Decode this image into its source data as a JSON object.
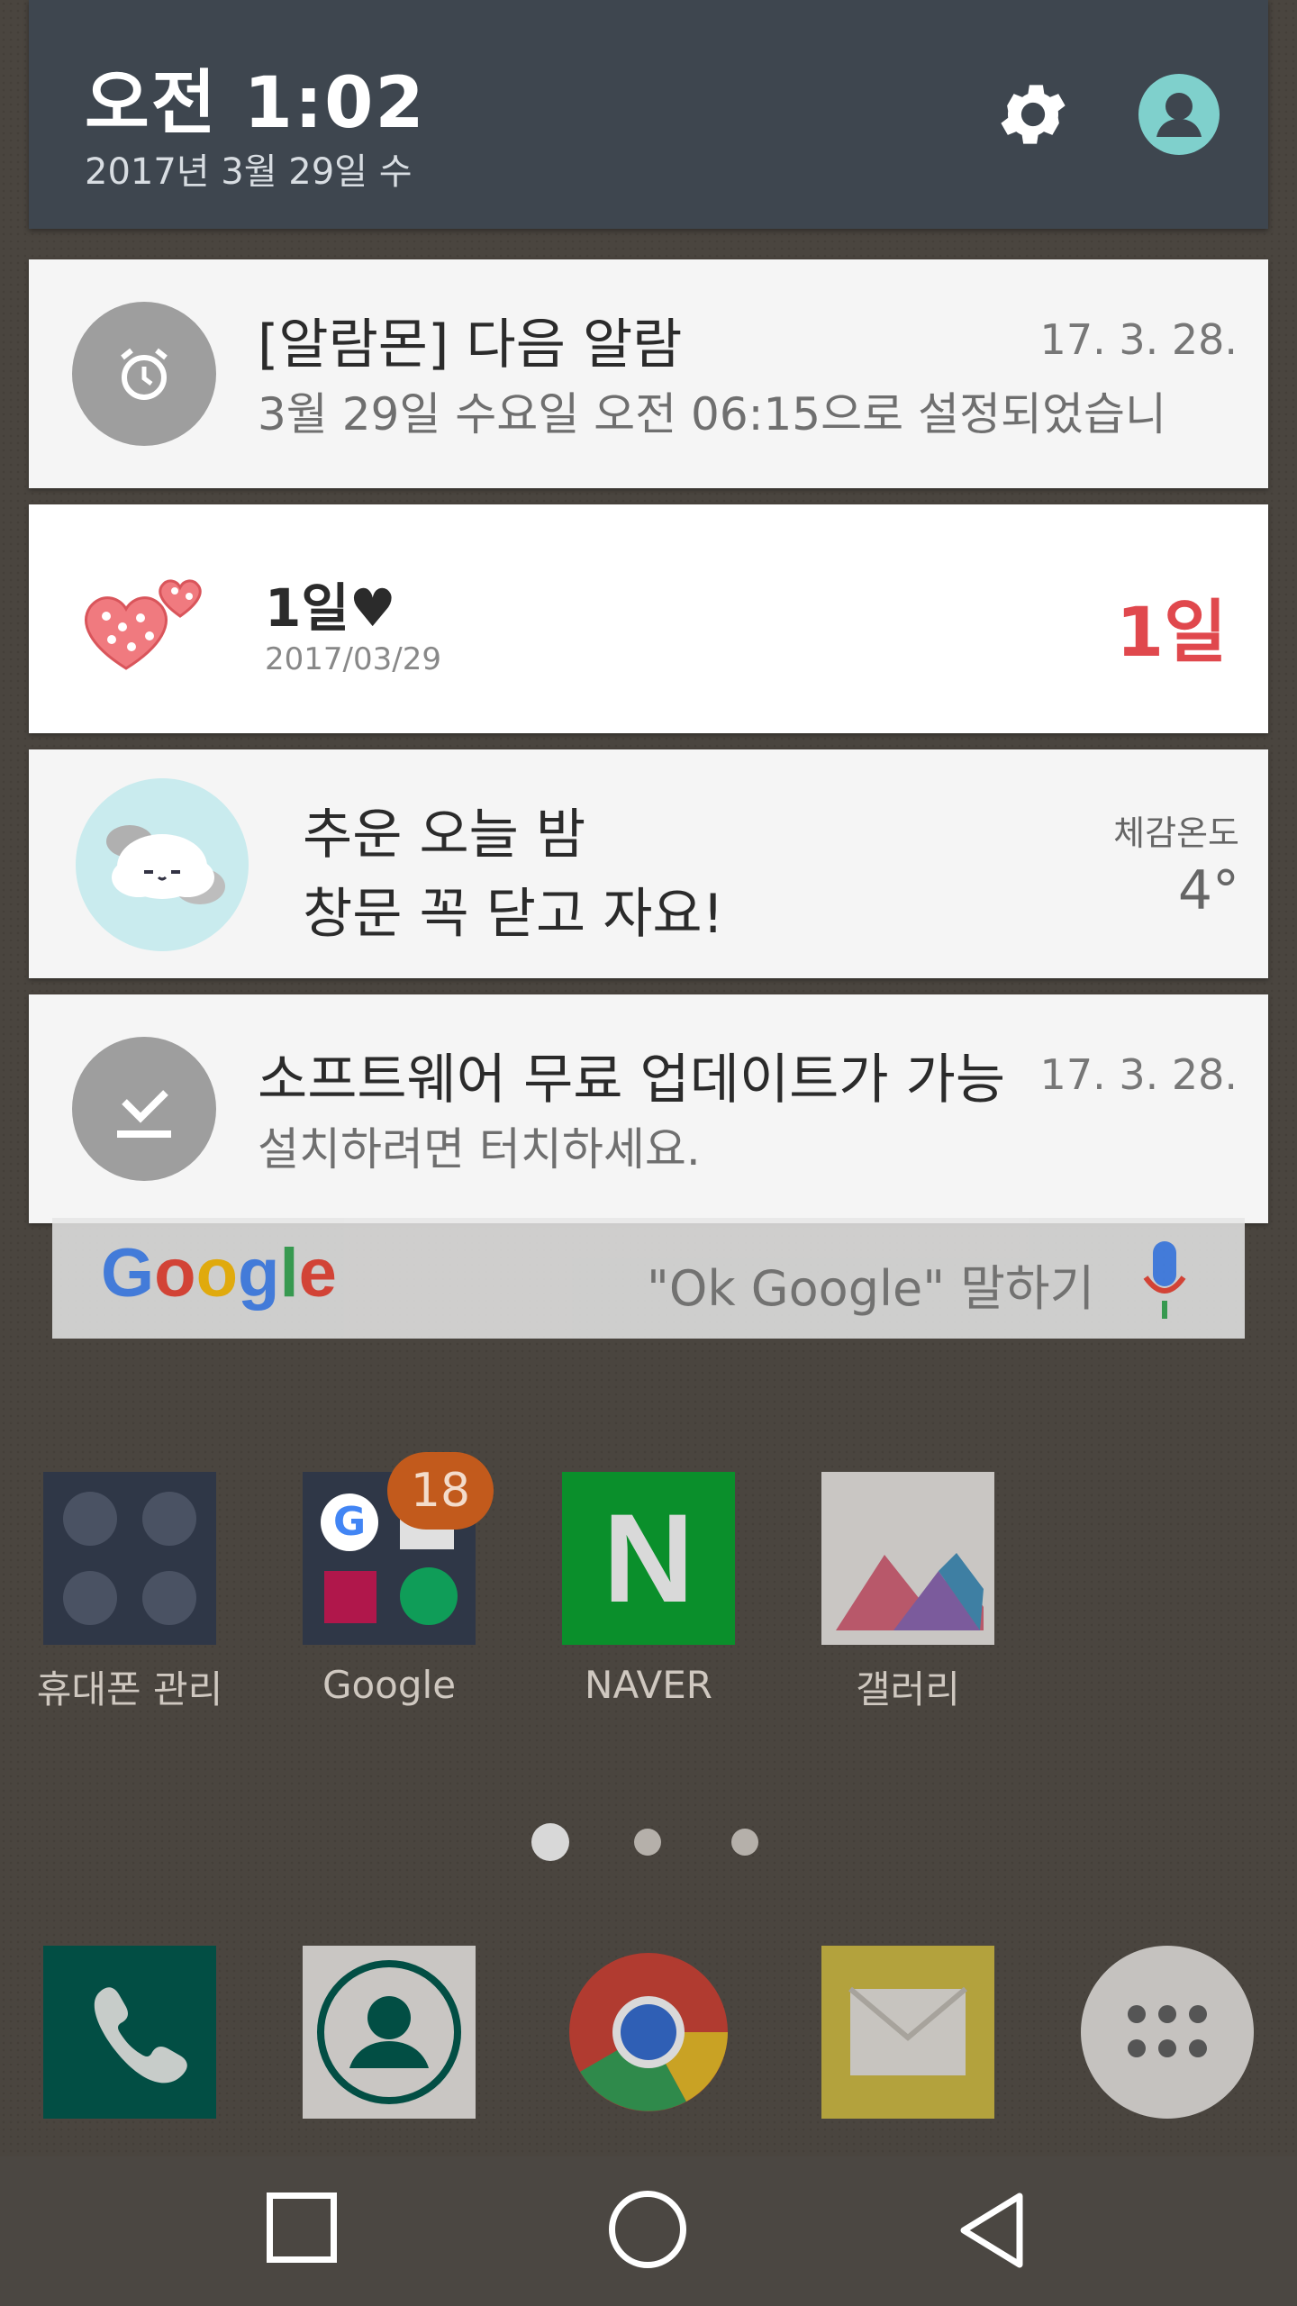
{
  "status": {
    "time": "오전 1:02",
    "date": "2017년 3월 29일 수"
  },
  "notifications": [
    {
      "title": "[알람몬] 다음 알람",
      "text": "3월 29일 수요일 오전 06:15으로 설정되었습니",
      "date": "17. 3. 28.",
      "icon": "alarm-clock-icon"
    },
    {
      "title": "1일♥",
      "subtitle": "2017/03/29",
      "count": "1일",
      "icon": "heart-icon"
    },
    {
      "line1": "추운 오늘 밤",
      "line2": "창문 꼭 닫고 자요!",
      "label": "체감온도",
      "temp": "4°",
      "icon": "cloud-icon"
    },
    {
      "title": "소프트웨어 무료 업데이트가 가능",
      "text": "설치하려면 터치하세요.",
      "date": "17. 3. 28.",
      "icon": "download-icon"
    }
  ],
  "search": {
    "logo": "Google",
    "hint": "\"Ok Google\" 말하기"
  },
  "apps": [
    {
      "label": "휴대폰 관리"
    },
    {
      "label": "Google",
      "badge": "18"
    },
    {
      "label": "NAVER",
      "glyph": "N"
    },
    {
      "label": "갤러리"
    }
  ],
  "colors": {
    "accent_red": "#e0484d",
    "qs_header": "#3e464f",
    "naver_green": "#03c75a"
  }
}
